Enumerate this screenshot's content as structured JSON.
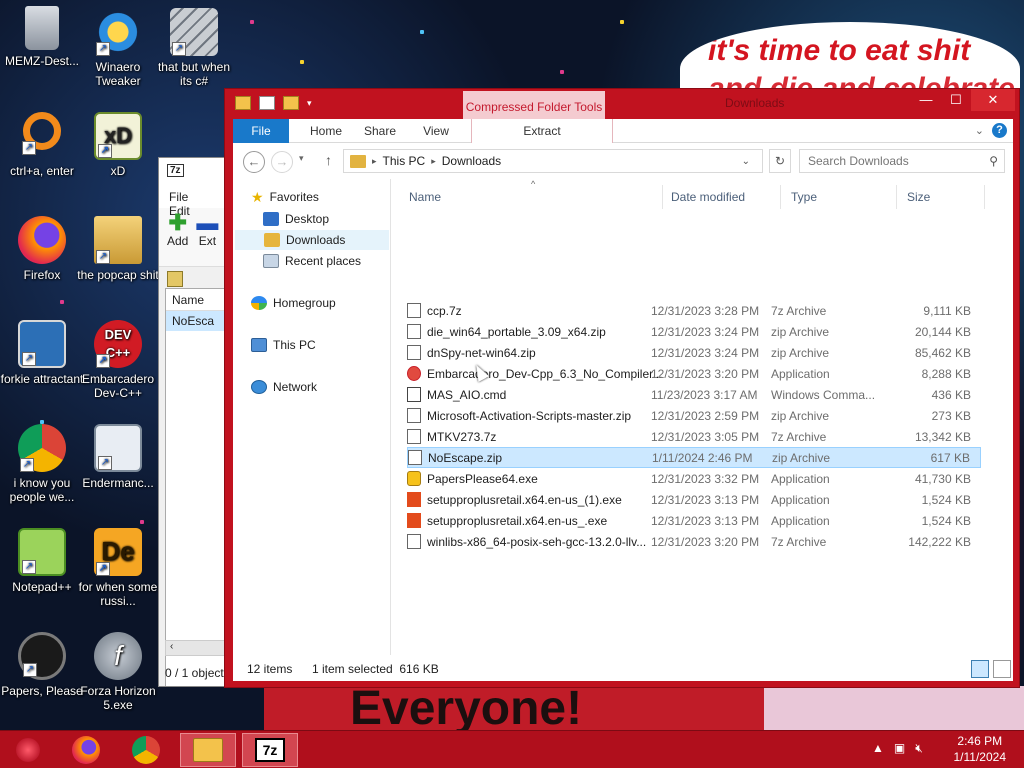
{
  "desktop": {
    "banner_line1": "it's time to eat shit",
    "banner_line2": "and die and celebrate",
    "bottom_banner": "Everyone!",
    "icons": [
      {
        "label": "MEMZ-Dest..."
      },
      {
        "label": "Winaero Tweaker"
      },
      {
        "label": "that but when its c#"
      },
      {
        "label": "ctrl+a, enter"
      },
      {
        "label": "xD"
      },
      {
        "label": "Firefox"
      },
      {
        "label": "the popcap shit"
      },
      {
        "label": "forkie attractant"
      },
      {
        "label": "Embarcadero Dev-C++"
      },
      {
        "label": "i know you people we..."
      },
      {
        "label": "Endermanc..."
      },
      {
        "label": "Notepad++"
      },
      {
        "label": "for when some russi..."
      },
      {
        "label": "Papers, Please"
      },
      {
        "label": "Forza Horizon 5.exe"
      }
    ]
  },
  "sevenzip": {
    "title_icon": "7z",
    "menu_file": "File",
    "menu_edit": "Edit",
    "add_label": "Add",
    "extract_label": "Ext",
    "col_name": "Name",
    "row_name": "NoEsca",
    "status": "0 / 1 object"
  },
  "explorer": {
    "window_title": "Downloads",
    "context_tab": "Compressed Folder Tools",
    "tabs": {
      "file": "File",
      "home": "Home",
      "share": "Share",
      "view": "View",
      "extract": "Extract"
    },
    "breadcrumb": [
      "This PC",
      "Downloads"
    ],
    "search_placeholder": "Search Downloads",
    "nav": {
      "favorites": "Favorites",
      "desktop": "Desktop",
      "downloads": "Downloads",
      "recent": "Recent places",
      "homegroup": "Homegroup",
      "thispc": "This PC",
      "network": "Network"
    },
    "columns": {
      "name": "Name",
      "date": "Date modified",
      "type": "Type",
      "size": "Size"
    },
    "files": [
      {
        "name": "ccp.7z",
        "date": "12/31/2023 3:28 PM",
        "type": "7z Archive",
        "size": "9,111 KB"
      },
      {
        "name": "die_win64_portable_3.09_x64.zip",
        "date": "12/31/2023 3:24 PM",
        "type": "zip Archive",
        "size": "20,144 KB"
      },
      {
        "name": "dnSpy-net-win64.zip",
        "date": "12/31/2023 3:24 PM",
        "type": "zip Archive",
        "size": "85,462 KB"
      },
      {
        "name": "Embarcadero_Dev-Cpp_6.3_No_Compiler...",
        "date": "12/31/2023 3:20 PM",
        "type": "Application",
        "size": "8,288 KB"
      },
      {
        "name": "MAS_AIO.cmd",
        "date": "11/23/2023 3:17 AM",
        "type": "Windows Comma...",
        "size": "436 KB"
      },
      {
        "name": "Microsoft-Activation-Scripts-master.zip",
        "date": "12/31/2023 2:59 PM",
        "type": "zip Archive",
        "size": "273 KB"
      },
      {
        "name": "MTKV273.7z",
        "date": "12/31/2023 3:05 PM",
        "type": "7z Archive",
        "size": "13,342 KB"
      },
      {
        "name": "NoEscape.zip",
        "date": "1/11/2024 2:46 PM",
        "type": "zip Archive",
        "size": "617 KB"
      },
      {
        "name": "PapersPlease64.exe",
        "date": "12/31/2023 3:32 PM",
        "type": "Application",
        "size": "41,730 KB"
      },
      {
        "name": "setupproplusretail.x64.en-us_(1).exe",
        "date": "12/31/2023 3:13 PM",
        "type": "Application",
        "size": "1,524 KB"
      },
      {
        "name": "setupproplusretail.x64.en-us_.exe",
        "date": "12/31/2023 3:13 PM",
        "type": "Application",
        "size": "1,524 KB"
      },
      {
        "name": "winlibs-x86_64-posix-seh-gcc-13.2.0-llv...",
        "date": "12/31/2023 3:20 PM",
        "type": "7z Archive",
        "size": "142,222 KB"
      }
    ],
    "status_items": "12 items",
    "status_selected": "1 item selected  616 KB"
  },
  "taskbar": {
    "time": "2:46 PM",
    "date": "1/11/2024",
    "sevenzip_label": "7z"
  }
}
